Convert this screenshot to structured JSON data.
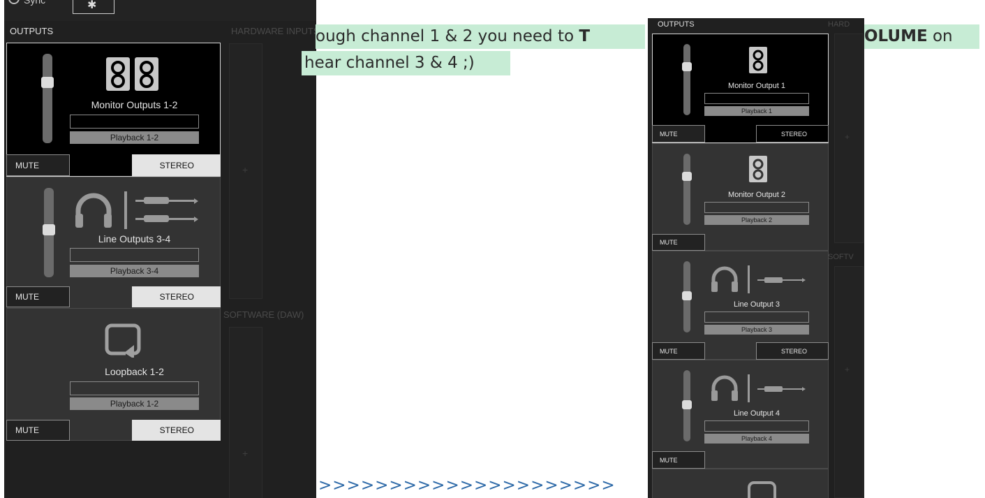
{
  "left_panel": {
    "sync_label": "Sync",
    "outputs_label": "OUTPUTS",
    "hardware_label": "HARDWARE INPUTS",
    "software_label": "SOFTWARE (DAW)",
    "plus": "+",
    "cards": [
      {
        "name": "Monitor Outputs 1-2",
        "playback": "Playback 1-2",
        "mute": "MUTE",
        "stereo": "STEREO",
        "icon": "speaker-pair-icon",
        "slider_level": 0.65
      },
      {
        "name": "Line Outputs 3-4",
        "playback": "Playback 3-4",
        "mute": "MUTE",
        "stereo": "STEREO",
        "icon": "headphones-and-jacks-icon",
        "slider_level": 0.5
      },
      {
        "name": "Loopback 1-2",
        "playback": "Playback 1-2",
        "mute": "MUTE",
        "stereo": "STEREO",
        "icon": "loopback-icon"
      }
    ]
  },
  "overlay": {
    "line1_start": "ough channel 1 & 2 you need to ",
    "line1_bold": "T",
    "line1_bold_end": "OLUME",
    "line1_end": " on",
    "line2": "hear channel 3 & 4 ;)",
    "arrows": ">>>>>>>>>>>>>>>>>>>>>"
  },
  "right_panel": {
    "outputs_label": "OUTPUTS",
    "hardware_label": "HARD",
    "software_label": "SOFTV",
    "plus": "+",
    "cards": [
      {
        "name": "Monitor Output 1",
        "playback": "Playback 1",
        "mute": "MUTE",
        "stereo": "STEREO",
        "icon": "speaker-icon"
      },
      {
        "name": "Monitor Output 2",
        "playback": "Playback 2",
        "mute": "MUTE",
        "icon": "speaker-icon"
      },
      {
        "name": "Line Output 3",
        "playback": "Playback 3",
        "mute": "MUTE",
        "stereo": "STEREO",
        "icon": "headphones-jack-icon"
      },
      {
        "name": "Line Output 4",
        "playback": "Playback 4",
        "mute": "MUTE",
        "icon": "headphones-jack-icon"
      }
    ]
  },
  "colors": {
    "panel_bg": "#202020",
    "card_bg": "#333333",
    "selected_bg": "#000000",
    "highlight": "#c7ecd5",
    "arrow_blue": "#2e6aa8"
  }
}
